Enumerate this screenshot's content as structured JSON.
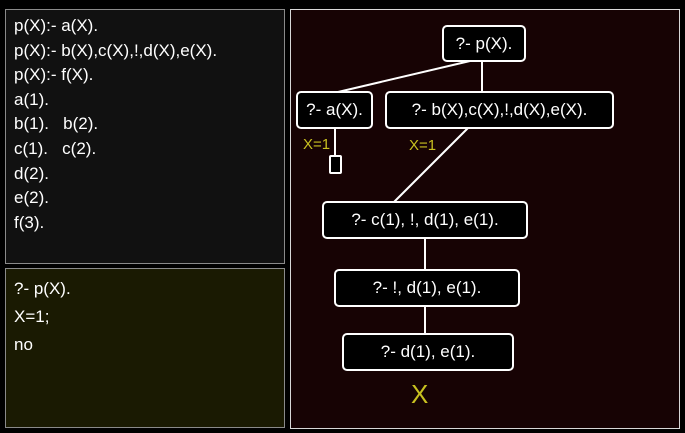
{
  "program": {
    "lines": [
      "p(X):- a(X).",
      "p(X):- b(X),c(X),!,d(X),e(X).",
      "p(X):- f(X).",
      "a(1).",
      "b(1).   b(2).",
      "c(1).   c(2).",
      "d(2).",
      "e(2).",
      "f(3)."
    ]
  },
  "query_console": {
    "lines": [
      "?- p(X).",
      "X=1;",
      "no"
    ]
  },
  "search_tree": {
    "nodes": {
      "root": "?- p(X).",
      "a": "?- a(X).",
      "b": "?- b(X),c(X),!,d(X),e(X).",
      "c": "?- c(1), !, d(1), e(1).",
      "cut": "?- !, d(1), e(1).",
      "d": "?- d(1), e(1)."
    },
    "bindings": {
      "a": "X=1",
      "b": "X=1"
    },
    "fail_mark": "X",
    "colors": {
      "label": "#c8c020",
      "background": "#170304"
    }
  }
}
